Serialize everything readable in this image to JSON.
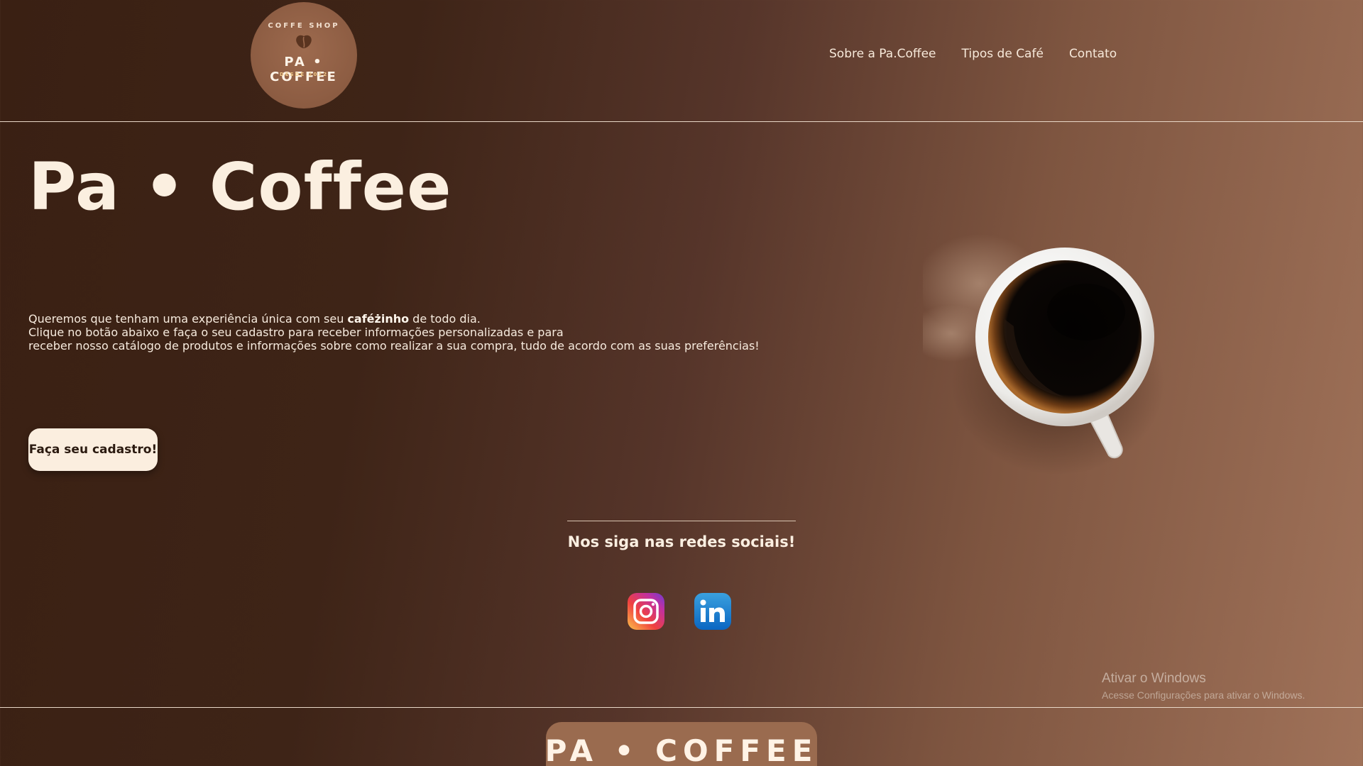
{
  "header": {
    "logo": {
      "arc_text": "COFFE SHOP",
      "main_text": "PA • COFFEE",
      "sub_text": "DESDE 2022"
    },
    "nav": [
      {
        "label": "Sobre a Pa.Coffee"
      },
      {
        "label": "Tipos de Café"
      },
      {
        "label": "Contato"
      }
    ]
  },
  "hero": {
    "title": "Pa • Coffee",
    "line1_pre": "Queremos que tenham uma experiência única com seu ",
    "line1_bold": "caféżinho",
    "line1_post": " de todo dia.",
    "line2": "Clique no botão abaixo e faça o seu cadastro para receber informações personalizadas e para",
    "line3": "receber nosso catálogo de produtos e informações sobre como realizar a sua compra, tudo de acordo com as suas preferências!",
    "cta_label": "Faça seu cadastro!"
  },
  "social": {
    "title": "Nos siga nas redes sociais!",
    "icons": [
      "instagram-icon",
      "linkedin-icon"
    ]
  },
  "watermark": {
    "title": "Ativar o Windows",
    "subtitle": "Acesse Configurações para ativar o Windows."
  },
  "footer": {
    "logo_text": "PA • COFFEE"
  },
  "colors": {
    "bg_dark": "#3a2013",
    "bg_light": "#a07259",
    "cream": "#fbeedf",
    "logo_brown": "#8c5c42"
  }
}
